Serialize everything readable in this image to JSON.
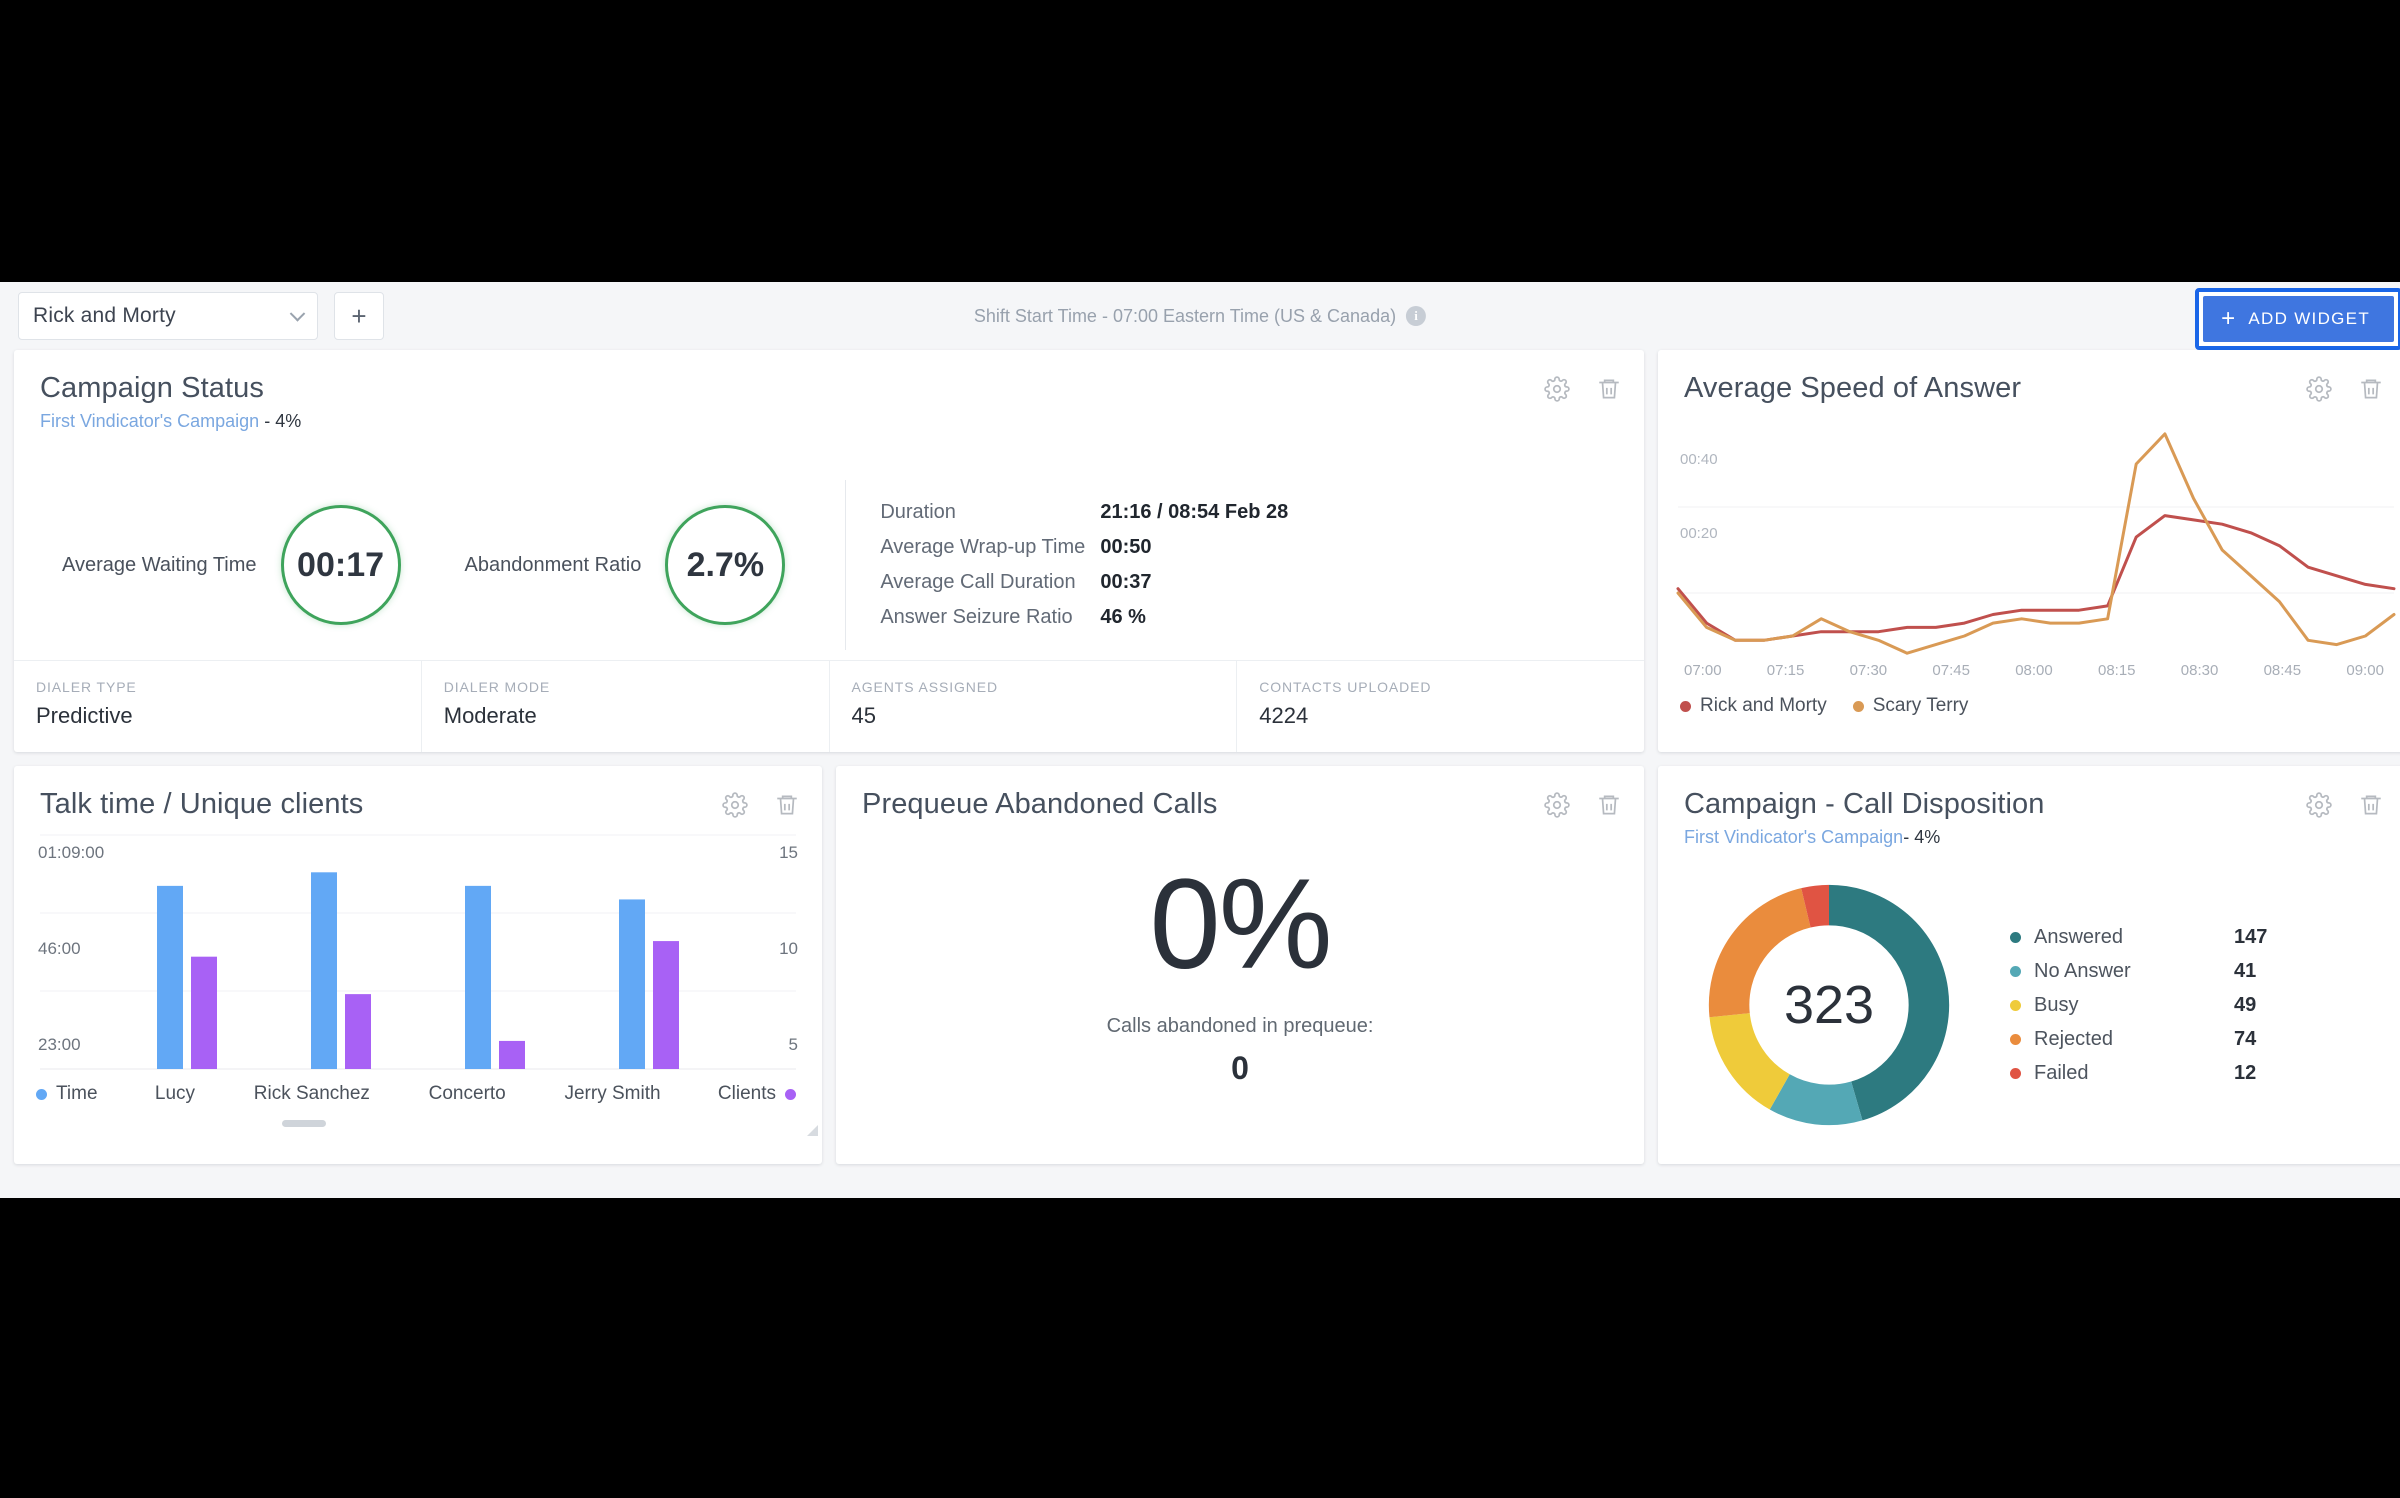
{
  "topbar": {
    "dashboard_select_value": "Rick and Morty",
    "add_dashboard_label": "+",
    "shift_info": "Shift Start Time - 07:00 Eastern Time (US & Canada)",
    "info_icon_glyph": "i",
    "add_widget_label": "ADD WIDGET",
    "add_widget_plus": "+",
    "accent_blue": "#3f76e0",
    "focus_outline": "#1a66e8"
  },
  "campaign_status": {
    "title": "Campaign Status",
    "campaign_name": "First Vindicator's Campaign",
    "campaign_pct": " - 4%",
    "gauges": [
      {
        "label": "Average Waiting Time",
        "value": "00:17",
        "color": "#3fa45c"
      },
      {
        "label": "Abandonment Ratio",
        "value": "2.7%",
        "color": "#3fa45c"
      }
    ],
    "metrics": [
      {
        "key": "Duration",
        "value": "21:16 / 08:54 Feb 28"
      },
      {
        "key": "Average Wrap-up Time",
        "value": "00:50"
      },
      {
        "key": "Average Call Duration",
        "value": "00:37"
      },
      {
        "key": "Answer Seizure Ratio",
        "value": "46 %"
      }
    ],
    "footer_stats": [
      {
        "label": "DIALER TYPE",
        "value": "Predictive"
      },
      {
        "label": "DIALER MODE",
        "value": "Moderate"
      },
      {
        "label": "AGENTS ASSIGNED",
        "value": "45"
      },
      {
        "label": "CONTACTS UPLOADED",
        "value": "4224"
      }
    ]
  },
  "speed_of_answer": {
    "title": "Average Speed of Answer"
  },
  "talk_time": {
    "title": "Talk time / Unique clients"
  },
  "prequeue": {
    "title": "Prequeue Abandoned Calls",
    "percent": "0%",
    "caption": "Calls abandoned in prequeue:",
    "count": "0"
  },
  "call_disposition": {
    "title": "Campaign - Call Disposition",
    "campaign_name": "First Vindicator's Campaign",
    "campaign_pct": "- 4%",
    "center_total": "323"
  },
  "chart_data": [
    {
      "type": "line",
      "title": "Average Speed of Answer",
      "xlabel": "",
      "ylabel": "",
      "grid": true,
      "legend_position": "bottom-left",
      "x": [
        "07:00",
        "07:05",
        "07:10",
        "07:15",
        "07:20",
        "07:25",
        "07:30",
        "07:35",
        "07:40",
        "07:45",
        "07:50",
        "07:55",
        "08:00",
        "08:05",
        "08:10",
        "08:15",
        "08:20",
        "08:25",
        "08:30",
        "08:35",
        "08:40",
        "08:45",
        "08:50",
        "08:55",
        "09:00",
        "09:05"
      ],
      "tick_labels": [
        "07:00",
        "07:15",
        "07:30",
        "07:45",
        "08:00",
        "08:15",
        "08:30",
        "08:45",
        "09:00"
      ],
      "ytick_labels": [
        "00:40",
        "00:20"
      ],
      "ylim": [
        0,
        60
      ],
      "series": [
        {
          "name": "Rick and Morty",
          "color": "#c0504d",
          "values": [
            21,
            13,
            9,
            9,
            10,
            11,
            11,
            11,
            12,
            12,
            13,
            15,
            16,
            16,
            16,
            17,
            33,
            38,
            37,
            36,
            34,
            31,
            26,
            24,
            22,
            21
          ]
        },
        {
          "name": "Scary Terry",
          "color": "#d99a55",
          "values": [
            20,
            12,
            9,
            9,
            10,
            14,
            11,
            9,
            6,
            8,
            10,
            13,
            14,
            13,
            13,
            14,
            50,
            57,
            42,
            30,
            24,
            18,
            9,
            8,
            10,
            15
          ]
        }
      ]
    },
    {
      "type": "bar",
      "title": "Talk time / Unique clients",
      "categories": [
        "Lucy",
        "Rick Sanchez",
        "Concerto",
        "Jerry Smith"
      ],
      "left_axis_labels": [
        "01:09:00",
        "46:00",
        "23:00"
      ],
      "right_axis_labels": [
        "15",
        "10",
        "5"
      ],
      "legend_left": "Time",
      "legend_right": "Clients",
      "series": [
        {
          "name": "Time",
          "color": "#62a8f5",
          "axis": "left",
          "values": [
            54,
            58,
            54,
            50
          ]
        },
        {
          "name": "Clients",
          "color": "#a861f5",
          "axis": "right",
          "values": [
            7.2,
            4.8,
            1.8,
            8.2
          ]
        }
      ]
    },
    {
      "type": "pie",
      "title": "Campaign - Call Disposition",
      "center_label": "323",
      "labels": [
        "Answered",
        "No Answer",
        "Busy",
        "Rejected",
        "Failed"
      ],
      "values": [
        147,
        41,
        49,
        74,
        12
      ],
      "colors": [
        "#2d7a80",
        "#54a8b5",
        "#efcb3a",
        "#ea8c3d",
        "#e05443"
      ],
      "legend_position": "right"
    }
  ],
  "icons": {
    "gear": "gear-icon",
    "trash": "trash-icon"
  }
}
